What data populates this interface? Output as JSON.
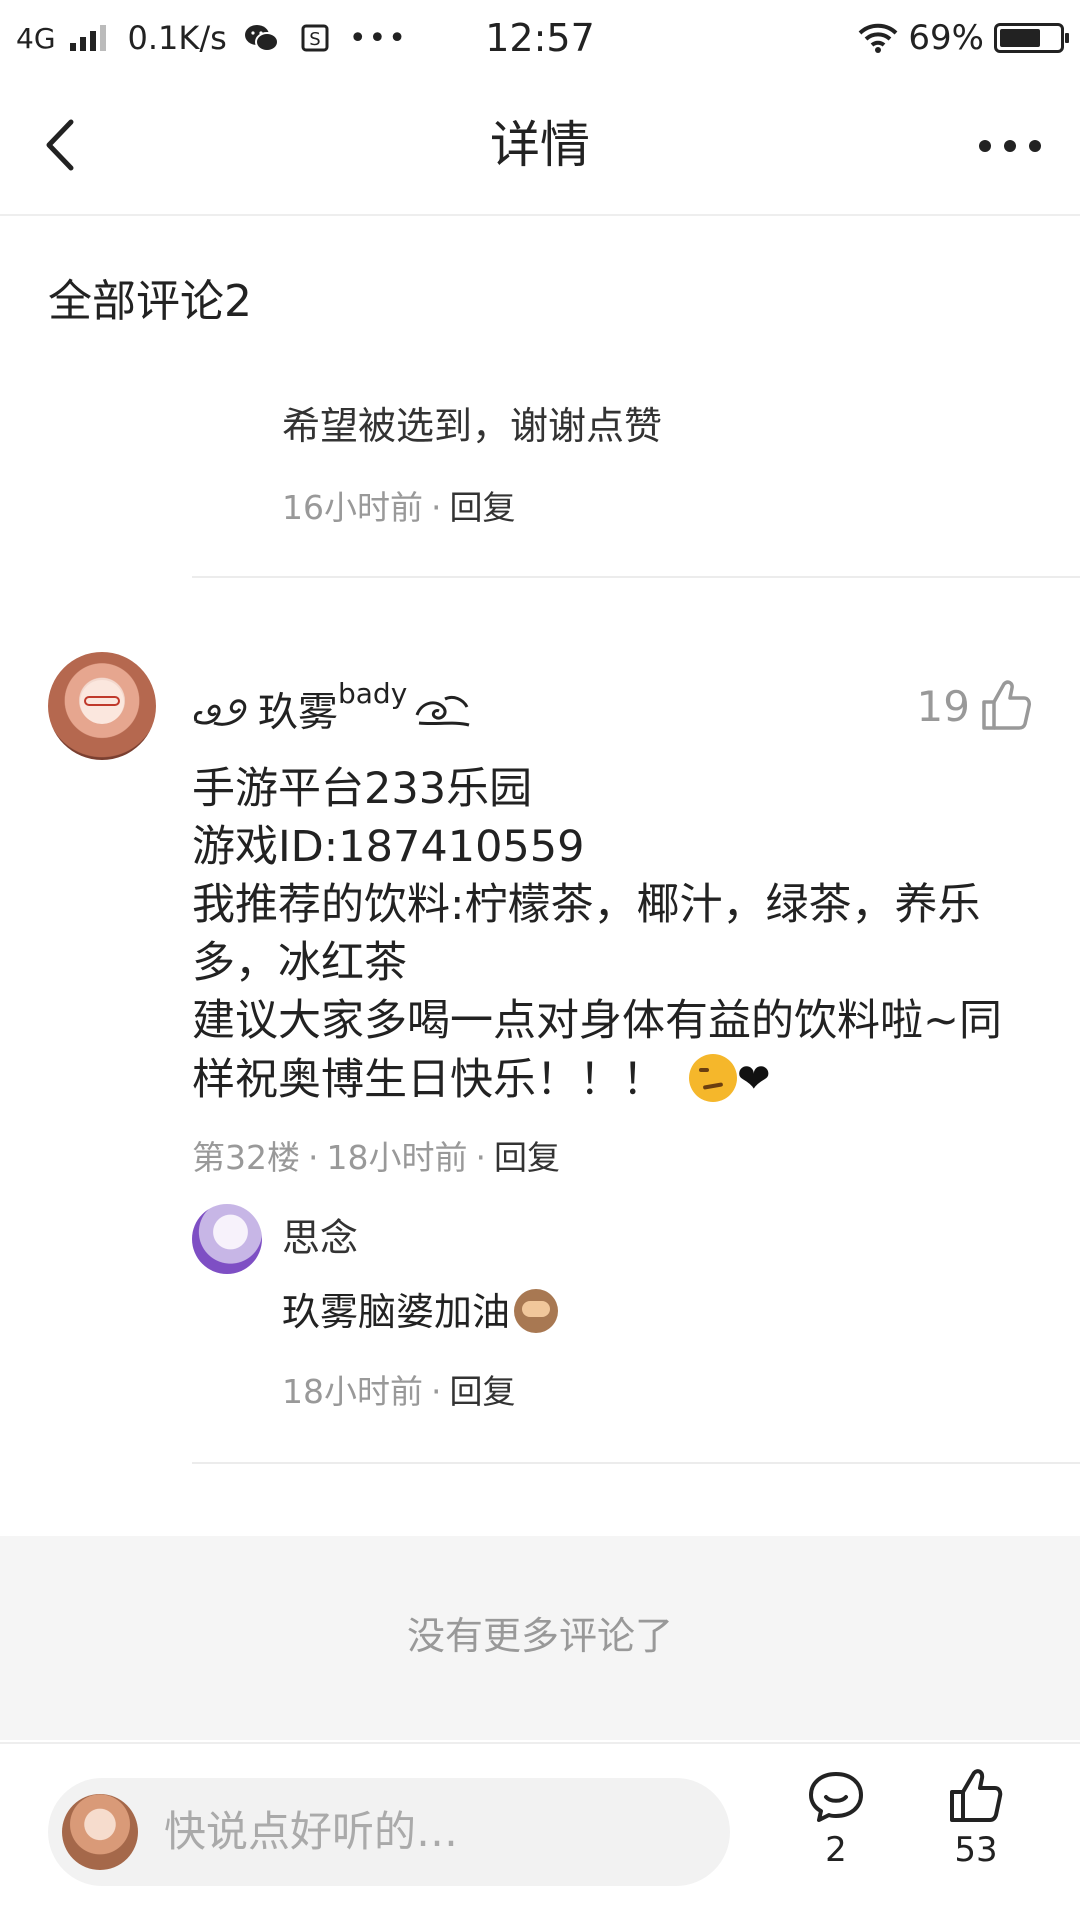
{
  "status_bar": {
    "network": "4G",
    "speed": "0.1K/s",
    "time": "12:57",
    "battery": "69%",
    "battery_level": 0.69,
    "icons": [
      "signal-icon",
      "wechat-icon",
      "s-app-icon",
      "more-dots-icon",
      "wifi-icon",
      "battery-icon"
    ]
  },
  "nav": {
    "title": "详情",
    "back_icon": "back-arrow-icon",
    "more_icon": "more-dots-icon"
  },
  "comments": {
    "header": "全部评论2",
    "partial": {
      "text": "希望被选到，谢谢点赞",
      "time": "16小时前",
      "reply_label": "回复"
    },
    "main": {
      "username": "玖雾",
      "username_sup": "bady",
      "likes": "19",
      "lines": [
        "手游平台233乐园",
        "游戏ID:187410559",
        "我推荐的饮料:柠檬茶，椰汁，绿茶，养乐多，冰红茶",
        "建议大家多喝一点对身体有益的饮料啦~同样祝奥博生日快乐！！！"
      ],
      "emojis": [
        "smirk-emoji",
        "black-heart-emoji"
      ],
      "heart": "❤",
      "floor": "第32楼",
      "time": "18小时前",
      "reply_label": "回复",
      "reply": {
        "username": "思念",
        "text": "玖雾脑婆加油",
        "emoji": "see-no-evil-monkey-emoji",
        "time": "18小时前",
        "reply_label": "回复"
      }
    },
    "end_text": "没有更多评论了"
  },
  "bottom_bar": {
    "placeholder": "快说点好听的…",
    "comment_count": "2",
    "like_count": "53"
  }
}
